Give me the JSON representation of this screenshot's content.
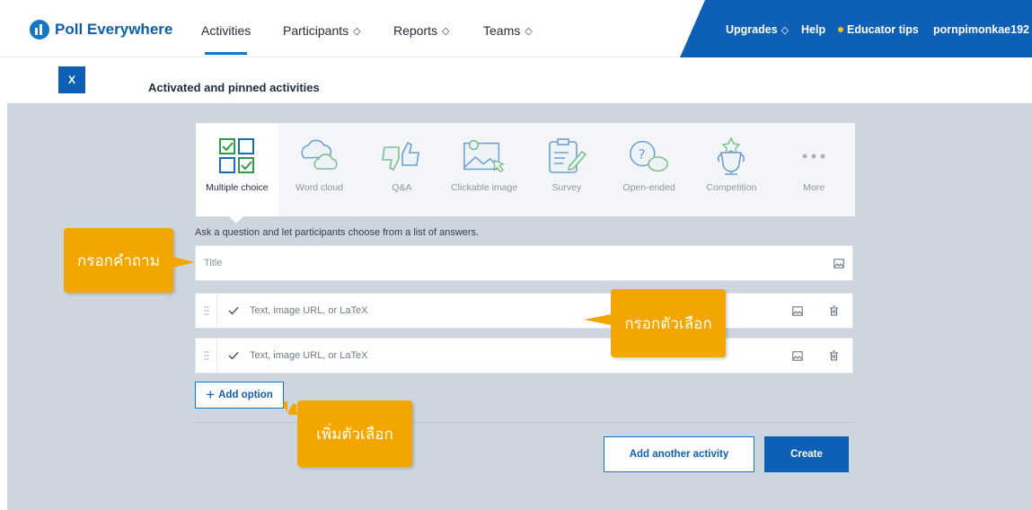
{
  "app": {
    "logo_text": "Poll Everywhere",
    "brand_color": "#0d60b6",
    "accent_color": "#f4a600"
  },
  "nav": {
    "items": [
      {
        "label": "Activities",
        "premium": false,
        "active": true
      },
      {
        "label": "Participants",
        "premium": true,
        "active": false
      },
      {
        "label": "Reports",
        "premium": true,
        "active": false
      },
      {
        "label": "Teams",
        "premium": true,
        "active": false
      }
    ],
    "upgrades": "Upgrades",
    "help": "Help",
    "educator_tips": "Educator tips",
    "username": "pornpimonkae192"
  },
  "subheader": {
    "close_label": "X",
    "title": "Activated and pinned activities"
  },
  "activity_types": [
    {
      "label": "Multiple choice",
      "icon": "multiple-choice-icon",
      "selected": true
    },
    {
      "label": "Word cloud",
      "icon": "word-cloud-icon",
      "selected": false
    },
    {
      "label": "Q&A",
      "icon": "qa-thumbs-icon",
      "selected": false
    },
    {
      "label": "Clickable image",
      "icon": "clickable-image-icon",
      "selected": false
    },
    {
      "label": "Survey",
      "icon": "survey-clipboard-icon",
      "selected": false
    },
    {
      "label": "Open-ended",
      "icon": "open-ended-icon",
      "selected": false
    },
    {
      "label": "Competition",
      "icon": "trophy-icon",
      "selected": false
    },
    {
      "label": "More",
      "icon": "more-dots-icon",
      "selected": false
    }
  ],
  "form": {
    "description": "Ask a question and let participants choose from a list of answers.",
    "title_placeholder": "Title",
    "options": [
      {
        "placeholder": "Text, image URL, or LaTeX"
      },
      {
        "placeholder": "Text, image URL, or LaTeX"
      }
    ],
    "add_option_label": "Add option",
    "add_another_label": "Add another activity",
    "create_label": "Create"
  },
  "callouts": {
    "question": "กรอกคำถาม",
    "options": "กรอกตัวเลือก",
    "add_option": "เพิ่มตัวเลือก"
  }
}
